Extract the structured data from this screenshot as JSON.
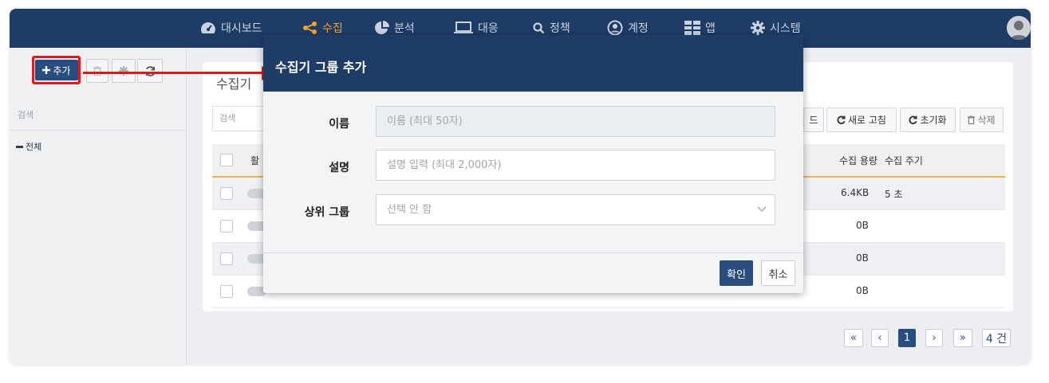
{
  "nav": {
    "items": [
      {
        "label": "대시보드",
        "icon": "dashboard-icon"
      },
      {
        "label": "수집",
        "icon": "share-icon",
        "active": true
      },
      {
        "label": "분석",
        "icon": "pie-chart-icon"
      },
      {
        "label": "대응",
        "icon": "laptop-icon"
      },
      {
        "label": "정책",
        "icon": "search-icon"
      },
      {
        "label": "계정",
        "icon": "user-circle-icon"
      },
      {
        "label": "앱",
        "icon": "grid-icon"
      },
      {
        "label": "시스템",
        "icon": "gear-icon"
      }
    ],
    "active_color": "#f6a232",
    "bg_color": "#1e3c66"
  },
  "sidebar": {
    "add_label": "추가",
    "search_placeholder": "검색",
    "tree_root": "전체"
  },
  "panel": {
    "title": "수집기",
    "search_placeholder": "검색",
    "buttons": {
      "partial_label": "드",
      "refresh_label": "새로 고침",
      "reset_label": "초기화",
      "delete_label": "삭제"
    },
    "columns": {
      "active_partial": "활",
      "size": "수집 용량",
      "period": "수집 주기"
    },
    "rows": [
      {
        "size": "6.4KB",
        "period": "5 초"
      },
      {
        "size": "0B",
        "period": ""
      },
      {
        "size": "0B",
        "period": ""
      },
      {
        "size": "0B",
        "period": ""
      }
    ]
  },
  "pagination": {
    "first": "«",
    "prev": "‹",
    "current": "1",
    "next": "›",
    "last": "»",
    "total": "4 건"
  },
  "modal": {
    "title": "수집기 그룹 추가",
    "name_label": "이름",
    "name_placeholder": "이름 (최대 50자)",
    "desc_label": "설명",
    "desc_placeholder": "설명 입력 (최대 2,000자)",
    "parent_label": "상위 그룹",
    "parent_value": "선택 안 함",
    "ok_label": "확인",
    "cancel_label": "취소"
  },
  "colors": {
    "primary": "#2a4d80",
    "highlight": "#e0191b",
    "accent": "#f0b24a"
  }
}
